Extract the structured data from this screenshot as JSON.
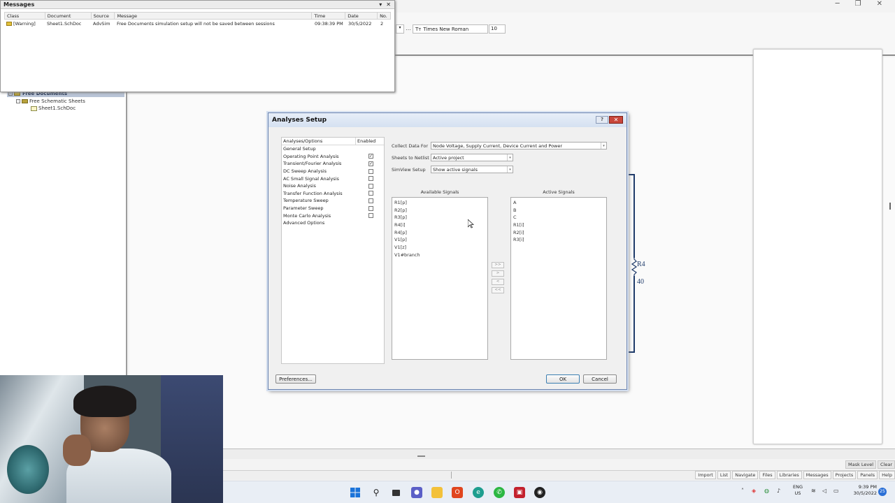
{
  "toolbar": {
    "font_name": "Times New Roman",
    "font_size": "10"
  },
  "messages_panel": {
    "title": "Messages",
    "columns": [
      "Class",
      "Document",
      "Source",
      "Message",
      "Time",
      "Date",
      "No."
    ],
    "rows": [
      {
        "class": "[Warning]",
        "document": "Sheet1.SchDoc",
        "source": "AdvSim",
        "message": "Free Documents simulation setup will not be saved between sessions",
        "time": "09:38:39 PM",
        "date": "30/5/2022",
        "no": "2"
      }
    ]
  },
  "project_tree": {
    "root": "Free Documents",
    "group": "Free Schematic Sheets",
    "file": "Sheet1.SchDoc"
  },
  "schematic": {
    "component_label": "R4",
    "component_value": "40"
  },
  "dialog": {
    "title": "Analyses Setup",
    "help_button": "?",
    "close_button": "✕",
    "list_headers": [
      "Analyses/Options",
      "Enabled"
    ],
    "analyses": [
      {
        "name": "General Setup",
        "checkbox": false,
        "checked": false
      },
      {
        "name": "Operating Point Analysis",
        "checkbox": true,
        "checked": true
      },
      {
        "name": "Transient/Fourier Analysis",
        "checkbox": true,
        "checked": true
      },
      {
        "name": "DC Sweep Analysis",
        "checkbox": true,
        "checked": false
      },
      {
        "name": "AC Small Signal Analysis",
        "checkbox": true,
        "checked": false
      },
      {
        "name": "Noise Analysis",
        "checkbox": true,
        "checked": false
      },
      {
        "name": "Transfer Function Analysis",
        "checkbox": true,
        "checked": false
      },
      {
        "name": "Temperature Sweep",
        "checkbox": true,
        "checked": false
      },
      {
        "name": "Parameter Sweep",
        "checkbox": true,
        "checked": false
      },
      {
        "name": "Monte Carlo Analysis",
        "checkbox": true,
        "checked": false
      },
      {
        "name": "Advanced Options",
        "checkbox": false,
        "checked": false
      }
    ],
    "collect_label": "Collect Data For",
    "collect_value": "Node Voltage, Supply Current, Device Current and Power",
    "sheets_label": "Sheets to Netlist",
    "sheets_value": "Active project",
    "simview_label": "SimView Setup",
    "simview_value": "Show active signals",
    "available_label": "Available Signals",
    "available_signals": [
      "R1[p]",
      "R2[p]",
      "R3[p]",
      "R4[i]",
      "R4[p]",
      "V1[p]",
      "V1[z]",
      "V1#branch"
    ],
    "active_label": "Active Signals",
    "active_signals": [
      "A",
      "B",
      "C",
      "R1[i]",
      "R2[i]",
      "R3[i]"
    ],
    "move_buttons": [
      ">>",
      ">",
      "<",
      "<<"
    ],
    "preferences_button": "Preferences...",
    "ok_button": "OK",
    "cancel_button": "Cancel"
  },
  "mask_bar": {
    "mask_level": "Mask Level",
    "clear": "Clear"
  },
  "panel_tabs": [
    "Import",
    "List",
    "Navigate",
    "Files",
    "Libraries",
    "Messages",
    "Projects",
    "Panels",
    "Help"
  ],
  "tray": {
    "lang": "ENG",
    "region": "US",
    "time": "9:39 PM",
    "date": "30/5/2022",
    "notifications": "25"
  }
}
